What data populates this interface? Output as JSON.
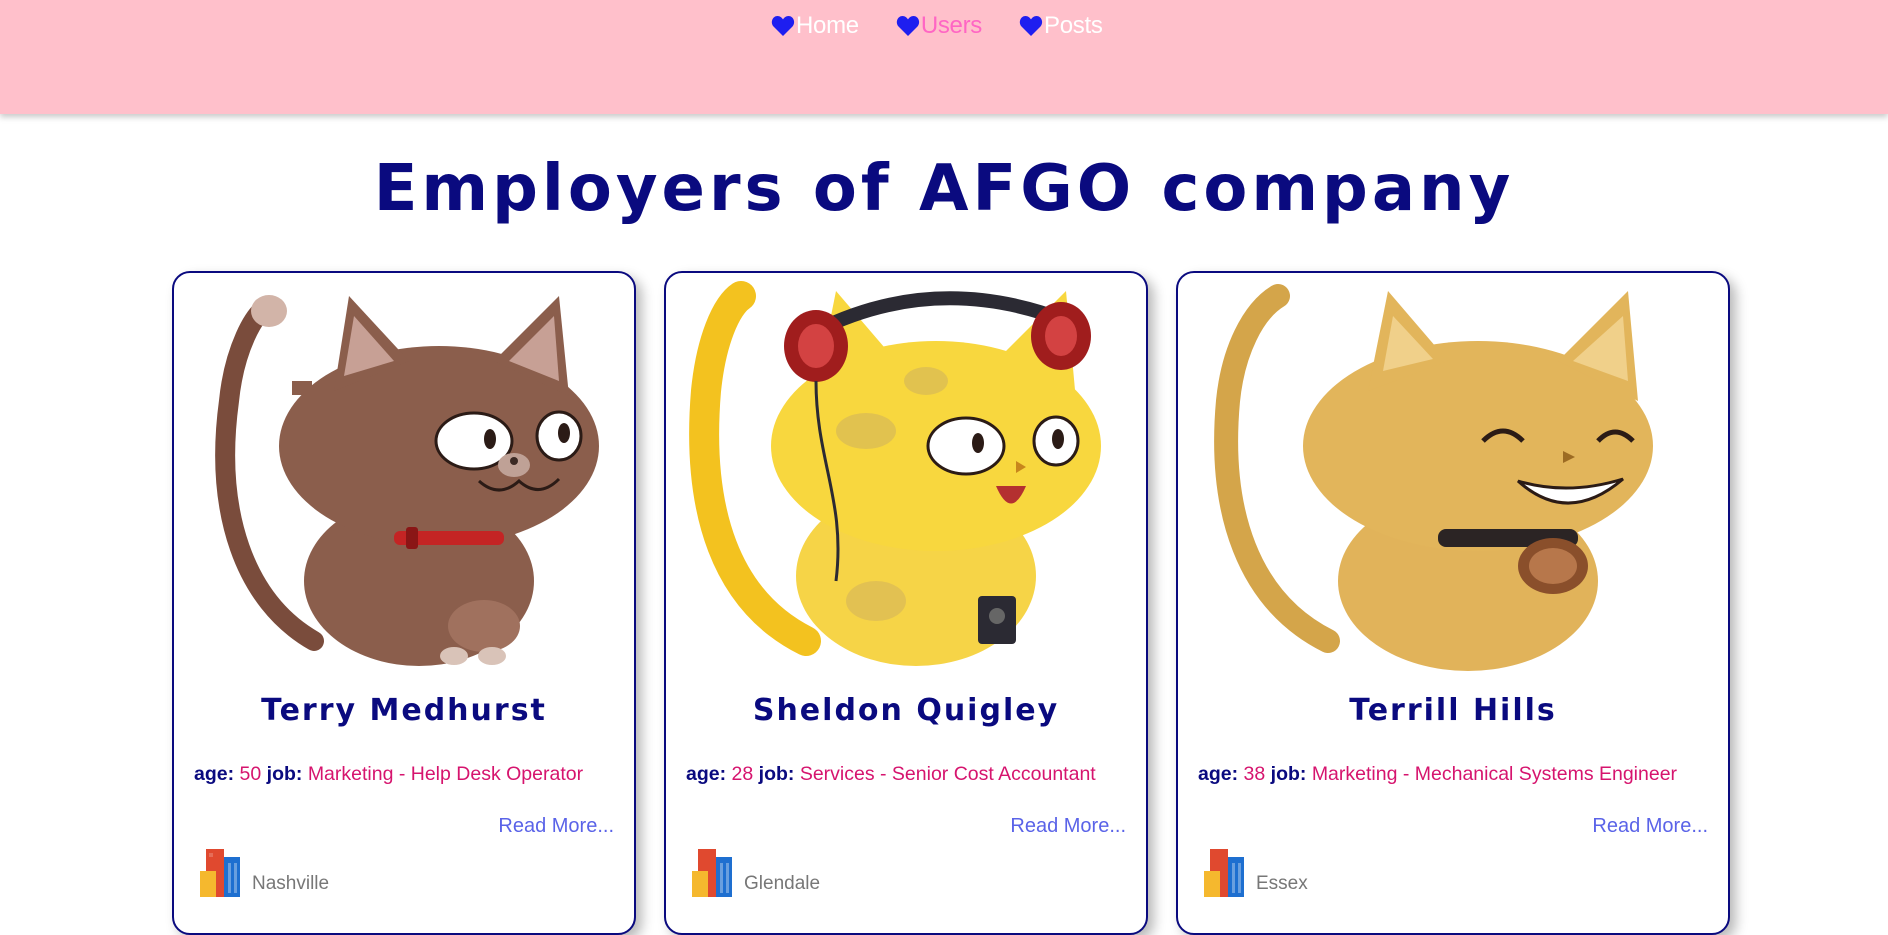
{
  "nav": {
    "items": [
      {
        "label": "Home",
        "icon": "heart-icon",
        "active": false
      },
      {
        "label": "Users",
        "icon": "heart-icon",
        "active": true
      },
      {
        "label": "Posts",
        "icon": "heart-icon",
        "active": false
      }
    ],
    "colors": {
      "bar": "#ffc0cb",
      "link": "#ffffff",
      "active": "#ff66c4",
      "heart": "#1e1ef0"
    }
  },
  "page": {
    "title": "Employers of AFGO company"
  },
  "labels": {
    "age": "age:",
    "job": "job:",
    "read_more": "Read More..."
  },
  "users": [
    {
      "name": "Terry Medhurst",
      "age": "50",
      "job": "Marketing - Help Desk Operator",
      "city": "Nashville",
      "avatar": "brown-cat-avatar"
    },
    {
      "name": "Sheldon Quigley",
      "age": "28",
      "job": "Services - Senior Cost Accountant",
      "city": "Glendale",
      "avatar": "yellow-cat-headphones-avatar"
    },
    {
      "name": "Terrill Hills",
      "age": "38",
      "job": "Marketing - Mechanical Systems Engineer",
      "city": "Essex",
      "avatar": "orange-cat-grin-avatar"
    }
  ]
}
